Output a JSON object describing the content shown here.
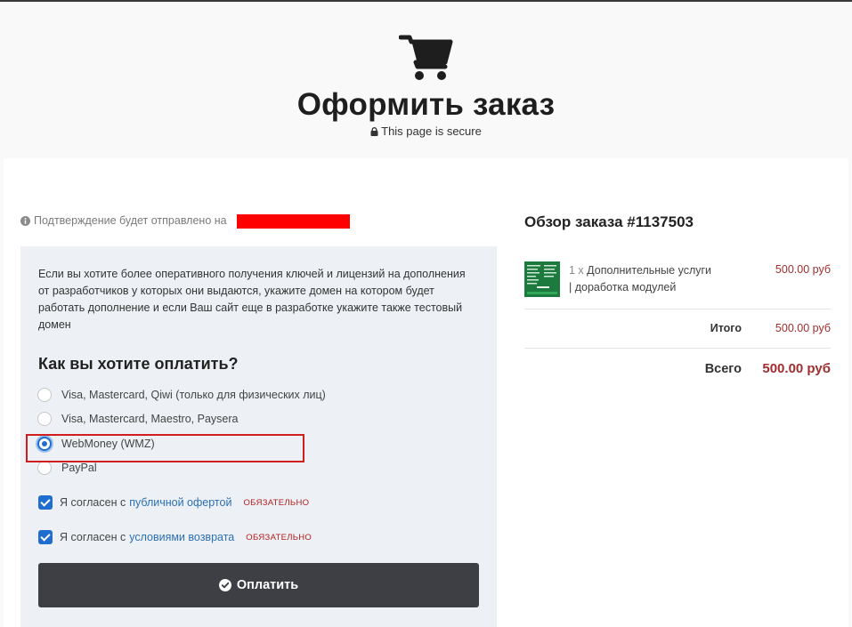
{
  "header": {
    "title": "Оформить заказ",
    "secure_note": "This page is secure"
  },
  "confirmation": {
    "text": "Подтверждение будет отправлено на"
  },
  "domain_note": "Если вы хотите более оперативного получения ключей и лицензий на дополнения от разработчиков у которых они выдаются, укажите домен на котором будет работать дополнение и если Ваш сайт еще в разработке укажите также тестовый домен",
  "payment": {
    "title": "Как вы хотите оплатить?",
    "methods": [
      {
        "label": "Visa, Mastercard, Qiwi (только для физических лиц)",
        "selected": false
      },
      {
        "label": "Visa, Mastercard, Maestro, Paysera",
        "selected": false
      },
      {
        "label": "WebMoney (WMZ)",
        "selected": true
      },
      {
        "label": "PayPal",
        "selected": false
      }
    ]
  },
  "agreements": [
    {
      "prefix": "Я согласен с",
      "link": "публичной офертой",
      "required": "ОБЯЗАТЕЛЬНО",
      "checked": true
    },
    {
      "prefix": "Я согласен с",
      "link": "условиями возврата",
      "required": "ОБЯЗАТЕЛЬНО",
      "checked": true
    }
  ],
  "pay_button": "Оплатить",
  "summary": {
    "title": "Обзор заказа #1137503",
    "item": {
      "qty": "1 x",
      "name": "Дополнительные услуги",
      "detail": "| доработка модулей",
      "price": "500.00 руб"
    },
    "subtotal_label": "Итого",
    "subtotal_value": "500.00 руб",
    "total_label": "Всего",
    "total_value": "500.00 руб"
  },
  "colors": {
    "accent": "#1f6ecf",
    "price": "#a12d2d",
    "button": "#3d3f44",
    "highlight": "#d11d1d"
  },
  "icons": [
    "shopping-cart-icon",
    "lock-icon",
    "info-icon",
    "check-circle-icon"
  ]
}
